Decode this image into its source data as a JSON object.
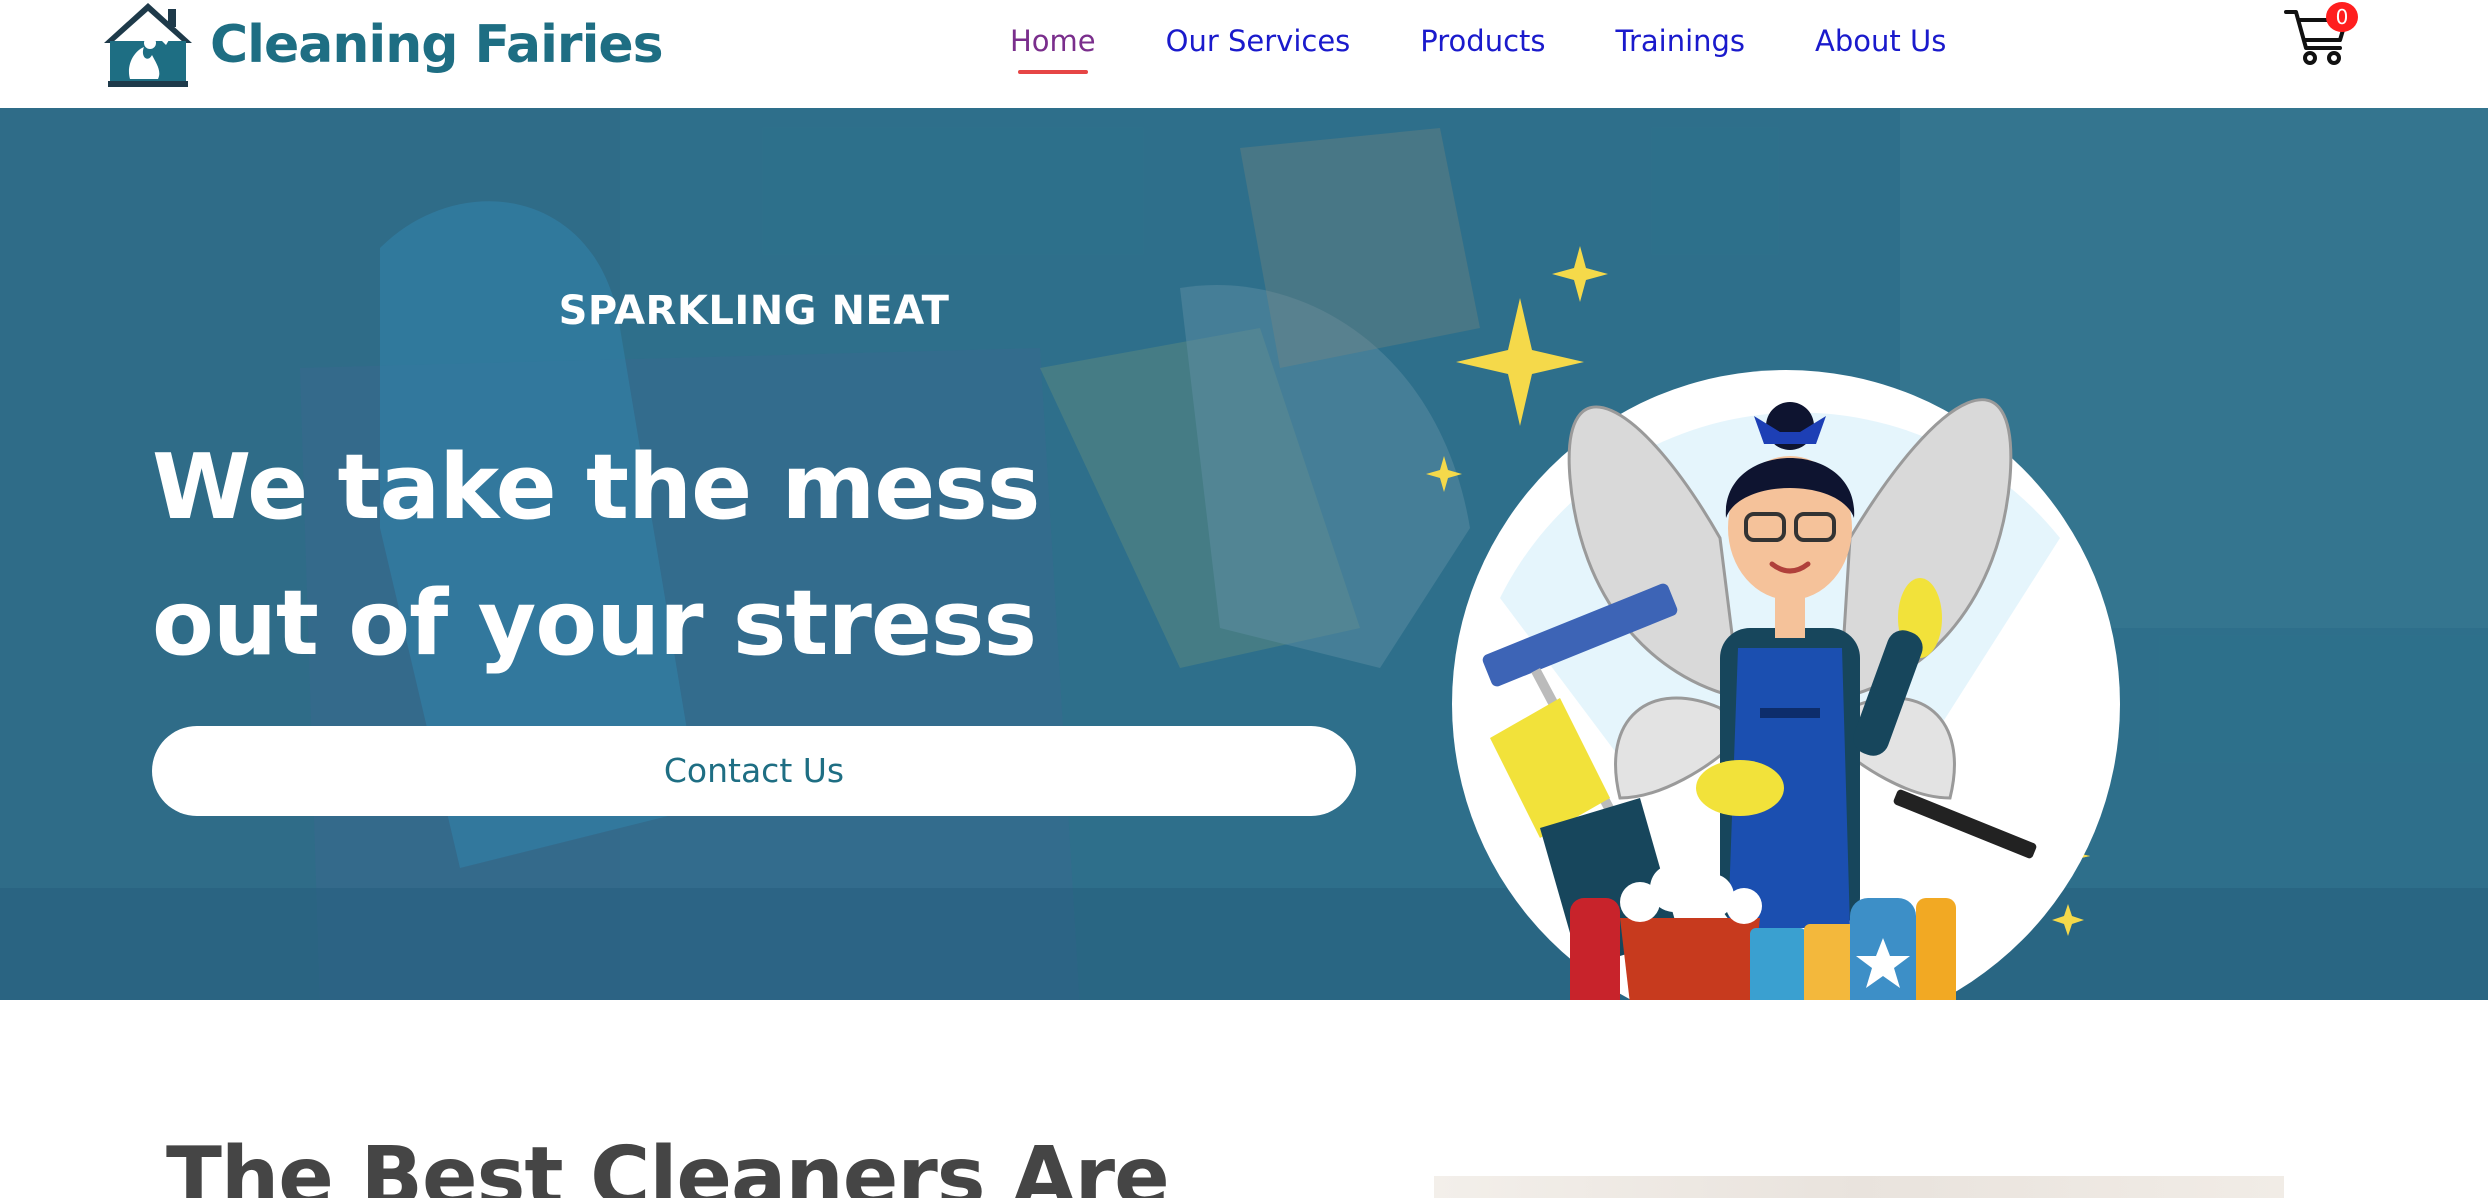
{
  "brand": {
    "name": "Cleaning Fairies"
  },
  "nav": {
    "items": [
      {
        "label": "Home",
        "active": true
      },
      {
        "label": "Our Services",
        "active": false
      },
      {
        "label": "Products",
        "active": false
      },
      {
        "label": "Trainings",
        "active": false
      },
      {
        "label": "About Us",
        "active": false
      }
    ]
  },
  "cart": {
    "count": "0",
    "icon": "shopping-cart-icon"
  },
  "hero": {
    "kicker": "SPARKLING NEAT",
    "title_line1": "We take the mess",
    "title_line2": "out of your stress",
    "cta_label": "Contact Us"
  },
  "section": {
    "heading": "The Best Cleaners Are"
  },
  "colors": {
    "brand_teal": "#1e6e83",
    "nav_link": "#1a1acc",
    "nav_active": "#7a2e8c",
    "active_underline": "#e64545",
    "cart_badge": "#ff1e1e",
    "hero_overlay": "#2d6b86"
  }
}
